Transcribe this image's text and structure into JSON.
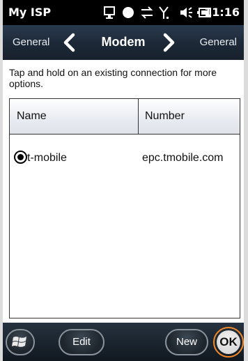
{
  "status_bar": {
    "app_title": "My ISP",
    "clock": "11:16",
    "icons": [
      "sync-icon",
      "record-dot-icon",
      "data-arrows-icon",
      "signal-icon",
      "volume-icon",
      "battery-icon"
    ]
  },
  "nav": {
    "left_label": "General",
    "title": "Modem",
    "right_label": "General",
    "prev_icon": "chevron-left-icon",
    "next_icon": "chevron-right-icon"
  },
  "hint": "Tap and hold on an existing connection for more options.",
  "table": {
    "columns": [
      "Name",
      "Number"
    ],
    "rows": [
      {
        "name": "t-mobile",
        "number": "epc.tmobile.com",
        "selected": true
      }
    ]
  },
  "bottom_bar": {
    "start_icon": "windows-logo-icon",
    "edit_label": "Edit",
    "new_label": "New",
    "ok_label": "OK"
  },
  "colors": {
    "ok_highlight": "#f28a2a",
    "navbar": "#1c2836"
  }
}
